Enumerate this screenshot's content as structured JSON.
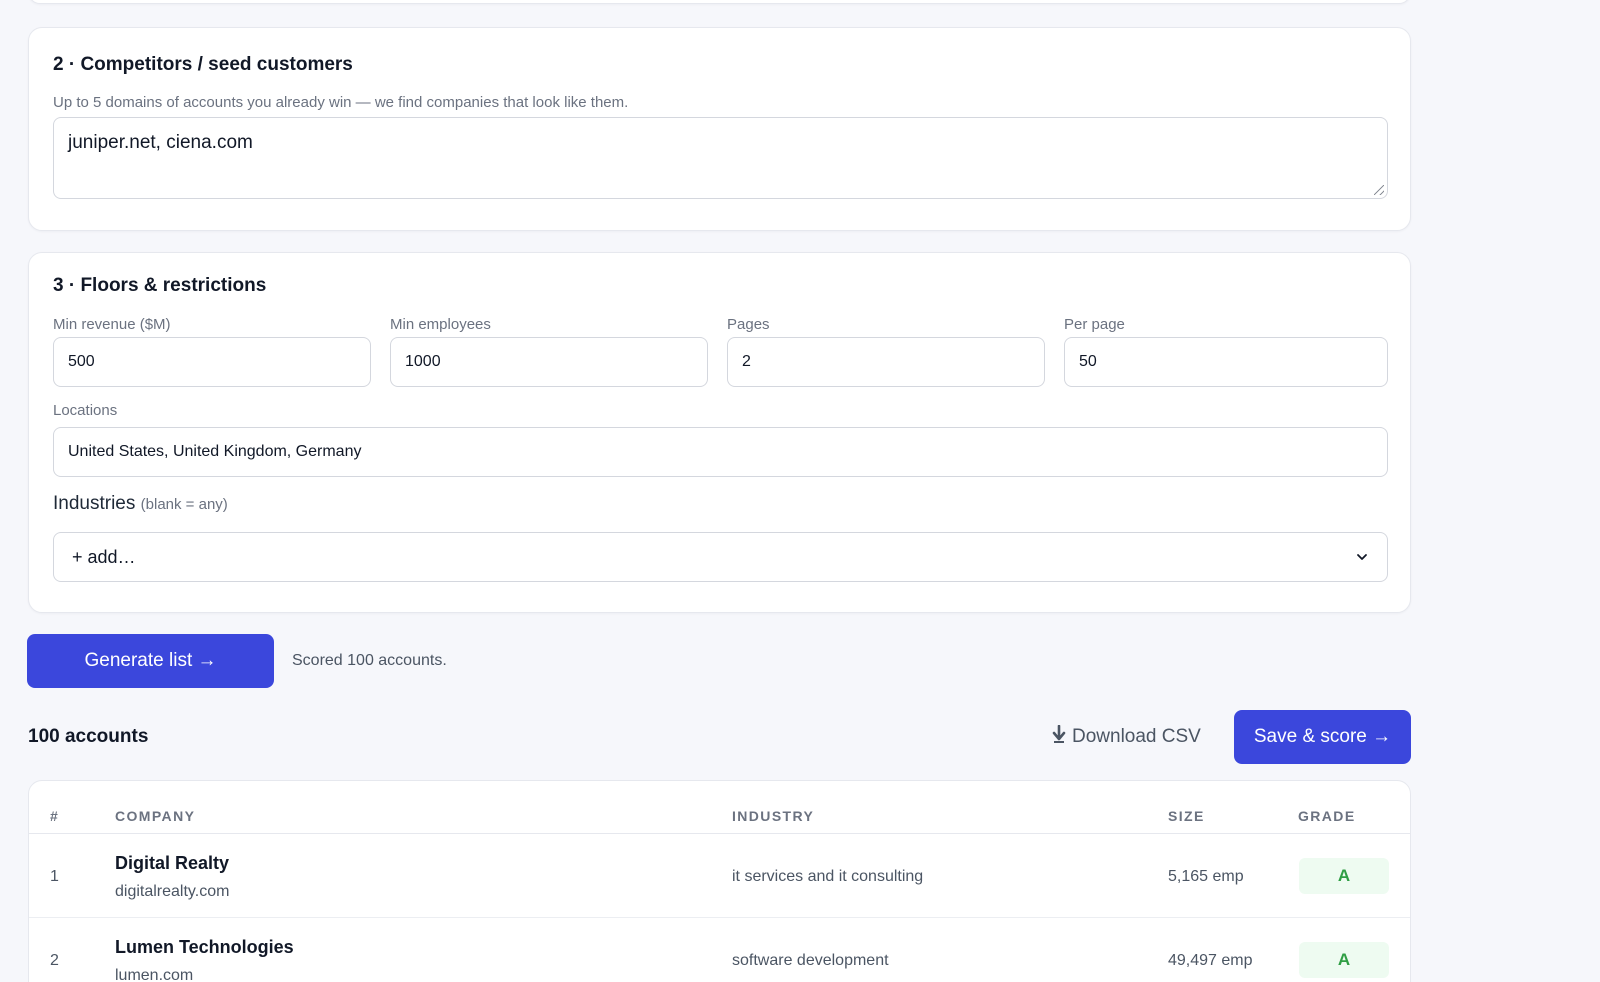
{
  "section2": {
    "title": "2 · Competitors / seed customers",
    "hint": "Up to 5 domains of accounts you already win — we find companies that look like them.",
    "value": "juniper.net, ciena.com"
  },
  "section3": {
    "title": "3 · Floors & restrictions",
    "fields": [
      {
        "label": "Min revenue ($M)",
        "value": "500"
      },
      {
        "label": "Min employees",
        "value": "1000"
      },
      {
        "label": "Pages",
        "value": "2"
      },
      {
        "label": "Per page",
        "value": "50"
      }
    ],
    "locations_label": "Locations",
    "locations_value": "United States, United Kingdom, Germany",
    "industries_label": "Industries",
    "industries_hint": "(blank = any)",
    "industries_select": "+ add…"
  },
  "actions": {
    "generate_label": "Generate list →",
    "status_text": "Scored 100 accounts.",
    "count_label": "100 accounts",
    "download_label": "Download CSV",
    "save_label": "Save & score →"
  },
  "table": {
    "headers": [
      "#",
      "COMPANY",
      "INDUSTRY",
      "SIZE",
      "GRADE"
    ],
    "rows": [
      {
        "num": "1",
        "name": "Digital Realty",
        "domain": "digitalrealty.com",
        "industry": "it services and it consulting",
        "size": "5,165 emp",
        "grade": "A"
      },
      {
        "num": "2",
        "name": "Lumen Technologies",
        "domain": "lumen.com",
        "industry": "software development",
        "size": "49,497 emp",
        "grade": "A"
      }
    ]
  },
  "colors": {
    "accent": "#3b47dc",
    "grade_bg": "#eefbf1",
    "grade_text": "#2f9e44"
  },
  "icons": {
    "download": "download-arrow-icon",
    "select": "chevron-down-icon"
  }
}
